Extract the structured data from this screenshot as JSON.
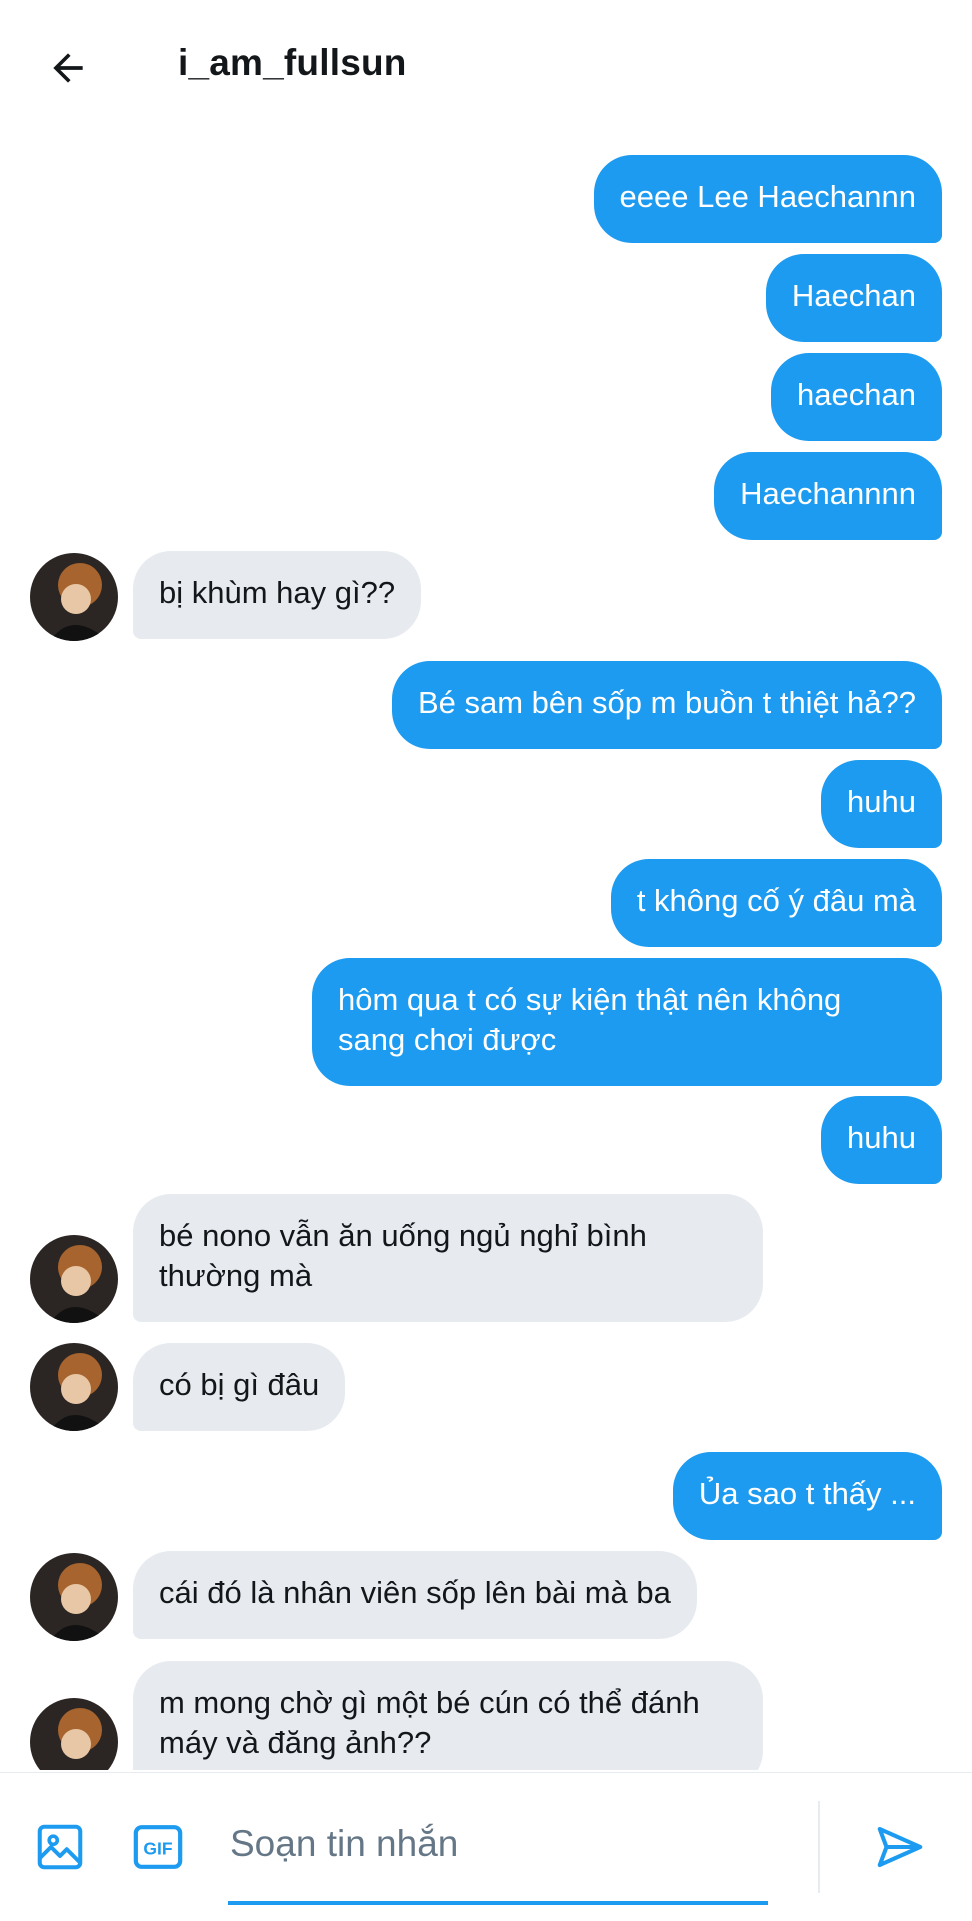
{
  "header": {
    "title": "i_am_fullsun"
  },
  "messages": [
    {
      "side": "sent",
      "text": "eeee Lee Haechannn"
    },
    {
      "side": "sent",
      "text": "Haechan"
    },
    {
      "side": "sent",
      "text": "haechan"
    },
    {
      "side": "sent",
      "text": "Haechannnn"
    },
    {
      "side": "recv",
      "text": "bị khùm hay gì??"
    },
    {
      "side": "sent",
      "text": "Bé sam bên sốp m buồn t thiệt hả??"
    },
    {
      "side": "sent",
      "text": "huhu"
    },
    {
      "side": "sent",
      "text": "t không cố ý đâu mà"
    },
    {
      "side": "sent",
      "text": "hôm qua t có sự kiện thật nên không sang chơi được"
    },
    {
      "side": "sent",
      "text": "huhu"
    },
    {
      "side": "recv",
      "text": "bé nono vẫn ăn uống ngủ nghỉ bình thường mà"
    },
    {
      "side": "recv",
      "text": "có bị gì đâu"
    },
    {
      "side": "sent",
      "text": "Ủa sao t thấy ..."
    },
    {
      "side": "recv",
      "text": "cái đó là nhân viên sốp lên bài mà ba"
    },
    {
      "side": "recv",
      "text": "m mong chờ gì một bé cún có thể đánh máy và đăng ảnh??"
    }
  ],
  "composer": {
    "placeholder": "Soạn tin nhắn",
    "gif_label": "GIF",
    "icons": [
      "image-icon",
      "gif-icon",
      "send-icon"
    ]
  },
  "colors": {
    "accent": "#1d9bf0",
    "received_bubble": "#e7ebef",
    "text": "#14171a",
    "placeholder": "#657786"
  }
}
